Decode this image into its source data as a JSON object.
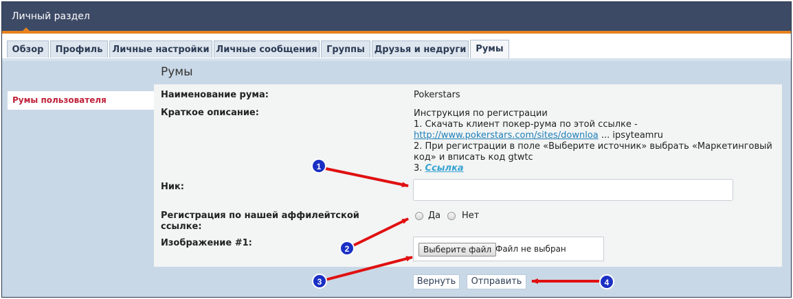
{
  "window": {
    "title": "Личный раздел"
  },
  "tabs": [
    {
      "label": "Обзор"
    },
    {
      "label": "Профиль"
    },
    {
      "label": "Личные настройки"
    },
    {
      "label": "Личные сообщения"
    },
    {
      "label": "Группы"
    },
    {
      "label": "Друзья и недруги"
    },
    {
      "label": "Румы",
      "active": true
    }
  ],
  "sidebar": {
    "items": [
      {
        "label": "Румы пользователя"
      }
    ]
  },
  "main": {
    "title": "Румы",
    "room_name_label": "Наименование рума:",
    "room_name_value": "Pokerstars",
    "description_label": "Краткое описание:",
    "description": {
      "line1": "Инструкция по регистрации",
      "line2": "1. Скачать клиент покер-рума по этой ссылке -",
      "link_text": "http://www.pokerstars.com/sites/downloa",
      "link_suffix": " ... ipsyteamru",
      "line4": "2. При регистрации в поле «Выберите источник» выбрать «Маркетинговый",
      "line5": "код» и вписать код gtwtc",
      "line6_prefix": "3. ",
      "line6_link": "Ссылка"
    },
    "nick_label": "Ник:",
    "nick_value": "",
    "affiliate_label_line1": "Регистрация по нашей аффилейтской",
    "affiliate_label_line2": "ссылке:",
    "affiliate_options": [
      {
        "label": "Да"
      },
      {
        "label": "Нет"
      }
    ],
    "image_label": "Изображение #1:",
    "file_button_label": "Выберите файл",
    "file_status": "Файл не выбран"
  },
  "actions": {
    "back_label": "Вернуть",
    "submit_label": "Отправить"
  },
  "annotations": [
    {
      "number": "1"
    },
    {
      "number": "2"
    },
    {
      "number": "3"
    },
    {
      "number": "4"
    }
  ],
  "colors": {
    "title_bar": "#3d4a66",
    "accent_orange": "#e7831e",
    "background": "#c9d8e6",
    "sidebar_active_text": "#c0223b",
    "arrow_red": "#e01010",
    "badge_blue": "#1a2fc4"
  }
}
